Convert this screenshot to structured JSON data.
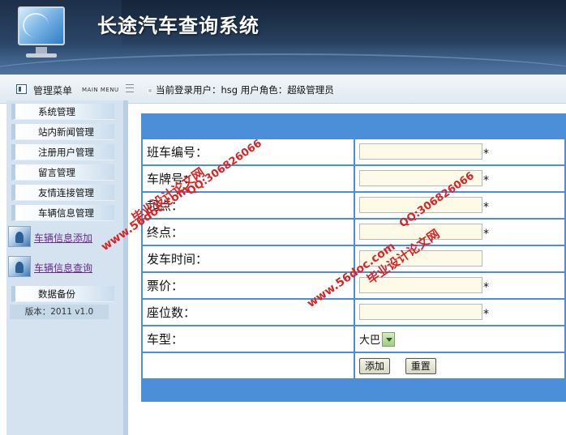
{
  "app": {
    "title": "长途汽车查询系统"
  },
  "menu": {
    "title": "管理菜单",
    "subtitle": "MAIN MENU"
  },
  "user_bar": {
    "text": "当前登录用户：hsg  用户角色：超级管理员"
  },
  "sidebar": {
    "items": [
      {
        "label": "系统管理"
      },
      {
        "label": "站内新闻管理"
      },
      {
        "label": "注册用户管理"
      },
      {
        "label": "留言管理"
      },
      {
        "label": "友情连接管理"
      },
      {
        "label": "车辆信息管理"
      }
    ],
    "sub_items": [
      {
        "label": "车辆信息添加"
      },
      {
        "label": "车辆信息查询"
      }
    ],
    "backup": {
      "label": "数据备份"
    },
    "version": "版本：2011 v1.0"
  },
  "form": {
    "fields": [
      {
        "label": "班车编号：",
        "value": "",
        "required": "*"
      },
      {
        "label": "车牌号：",
        "value": "",
        "required": "*"
      },
      {
        "label": "起点：",
        "value": "",
        "required": "*"
      },
      {
        "label": "终点：",
        "value": "",
        "required": "*"
      },
      {
        "label": "发车时间：",
        "value": "",
        "required": ""
      },
      {
        "label": "票价：",
        "value": "",
        "required": "*"
      },
      {
        "label": "座位数：",
        "value": "",
        "required": "*"
      }
    ],
    "bus_type": {
      "label": "车型：",
      "value": "大巴"
    },
    "buttons": {
      "add": "添加",
      "reset": "重置"
    }
  },
  "watermarks": {
    "site": "www.56doc.com",
    "qq": "QQ:306826066",
    "name": "毕业设计论文网"
  },
  "colors": {
    "header_bg": "#2a4466",
    "form_accent": "#4a8fd8",
    "sidebar_bg": "#d4e3ef",
    "watermark": "#d82424"
  }
}
